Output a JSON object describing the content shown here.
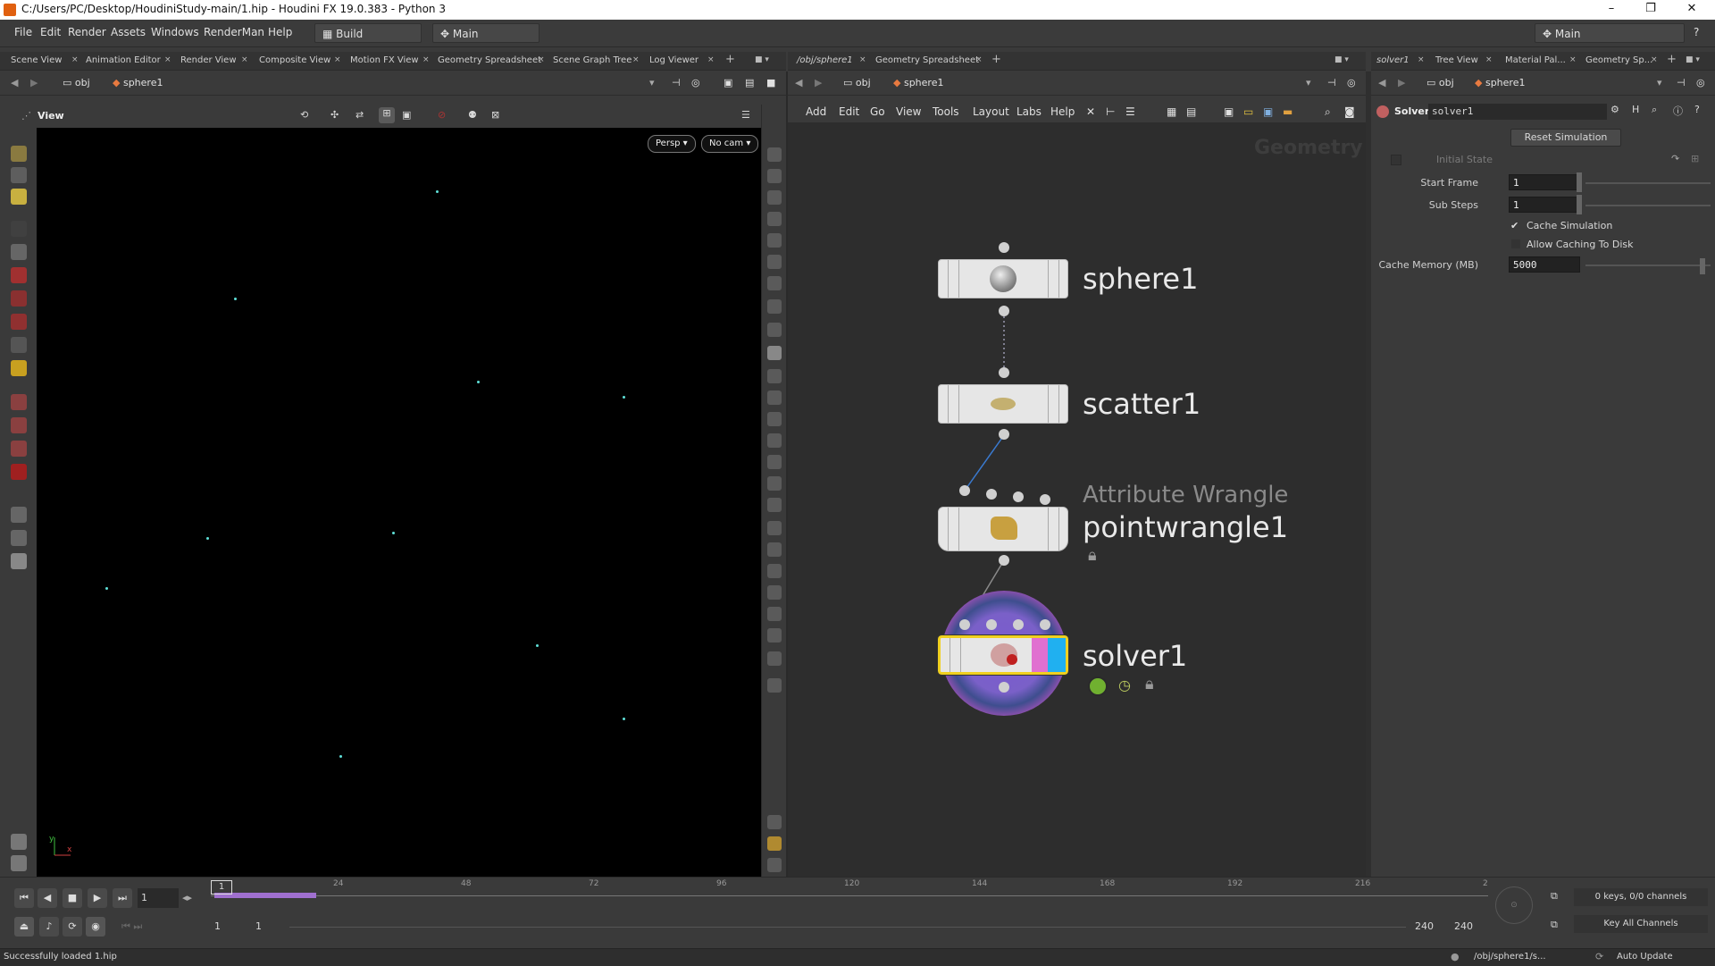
{
  "window": {
    "title": "C:/Users/PC/Desktop/HoudiniStudy-main/1.hip - Houdini FX 19.0.383 - Python 3",
    "minimize": "–",
    "maximize": "❐",
    "close": "✕"
  },
  "menubar": {
    "items": [
      "File",
      "Edit",
      "Render",
      "Assets",
      "Windows",
      "RenderMan",
      "Help"
    ],
    "shelf_set": "Build",
    "desktop": "Main",
    "right_desktop": "Main"
  },
  "left_tabs": [
    "Scene View",
    "Animation Editor",
    "Render View",
    "Composite View",
    "Motion FX View",
    "Geometry Spreadsheet",
    "Scene Graph Tree",
    "Log Viewer"
  ],
  "mid_tabs": [
    "/obj/sphere1",
    "Geometry Spreadsheet"
  ],
  "right_tabs": [
    "solver1",
    "Tree View",
    "Material Pal...",
    "Geometry Sp..."
  ],
  "left_path": {
    "root": "obj",
    "node": "sphere1"
  },
  "mid_path": {
    "root": "obj",
    "node": "sphere1"
  },
  "right_path": {
    "root": "obj",
    "node": "sphere1"
  },
  "viewport": {
    "title": "View",
    "persp_button": "Persp ▾",
    "cam_button": "No cam ▾"
  },
  "network_menu": [
    "Add",
    "Edit",
    "Go",
    "View",
    "Tools",
    "Layout",
    "Labs",
    "Help"
  ],
  "network": {
    "context_label": "Geometry",
    "nodes": [
      {
        "name": "sphere1"
      },
      {
        "name": "scatter1"
      },
      {
        "type_label": "Attribute Wrangle",
        "name": "pointwrangle1"
      },
      {
        "name": "solver1"
      }
    ]
  },
  "parameters": {
    "node_type": "Solver",
    "node_name": "solver1",
    "reset_button": "Reset Simulation",
    "initial_state_label": "Initial State",
    "start_frame_label": "Start Frame",
    "start_frame_value": "1",
    "sub_steps_label": "Sub Steps",
    "sub_steps_value": "1",
    "cache_simulation_label": "Cache Simulation",
    "cache_simulation_checked": "✔",
    "allow_caching_label": "Allow Caching To Disk",
    "cache_memory_label": "Cache Memory (MB)",
    "cache_memory_value": "5000"
  },
  "timeline": {
    "current_frame": "1",
    "frame_marker": "1",
    "ticks": [
      "24",
      "48",
      "72",
      "96",
      "120",
      "144",
      "168",
      "192",
      "216",
      "2"
    ],
    "range_start": "1",
    "range_start2": "1",
    "range_end": "240",
    "range_end2": "240",
    "keys_info": "0 keys, 0/0 channels",
    "key_all": "Key All Channels"
  },
  "status": {
    "message": "Successfully loaded 1.hip",
    "path": "/obj/sphere1/s...",
    "update_mode": "Auto Update"
  },
  "colors": {
    "viewport_bg": "#000000",
    "network_bg": "#2d2d2d",
    "point_color": "#5fe0d8",
    "solver_ring": "#9b5fb6",
    "selected_outline": "#f0d020",
    "cache_bar": "#a070d0"
  }
}
